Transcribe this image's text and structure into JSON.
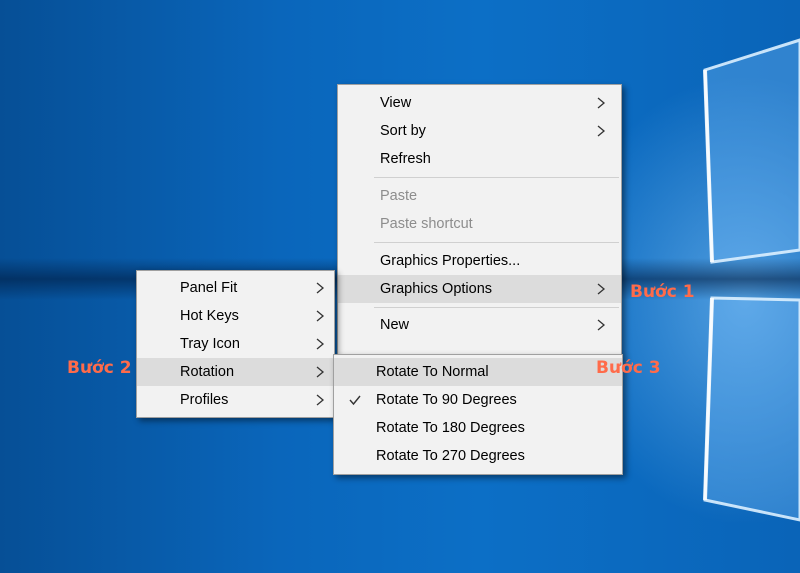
{
  "main_menu": {
    "items": [
      {
        "label": "View"
      },
      {
        "label": "Sort by"
      },
      {
        "label": "Refresh"
      },
      {
        "label": "Paste"
      },
      {
        "label": "Paste shortcut"
      },
      {
        "label": "Graphics Properties..."
      },
      {
        "label": "Graphics Options"
      },
      {
        "label": "New"
      }
    ]
  },
  "graphics_submenu": {
    "items": [
      {
        "label": "Panel Fit"
      },
      {
        "label": "Hot Keys"
      },
      {
        "label": "Tray Icon"
      },
      {
        "label": "Rotation"
      },
      {
        "label": "Profiles"
      }
    ]
  },
  "rotation_submenu": {
    "items": [
      {
        "label": "Rotate To Normal"
      },
      {
        "label": "Rotate To 90 Degrees",
        "checked": true
      },
      {
        "label": "Rotate To 180 Degrees"
      },
      {
        "label": "Rotate To 270 Degrees"
      }
    ]
  },
  "annotations": {
    "step1": "Bước 1",
    "step2": "Bước 2",
    "step3": "Bước 3"
  },
  "colors": {
    "annotation": "#ff6b4a",
    "menu_background": "#f2f2f2",
    "menu_highlight": "#dcdcdc",
    "disabled_text": "#8d8d8d"
  },
  "icons": {
    "submenu_arrow": "chevron-right-icon",
    "checkmark": "checkmark-icon"
  }
}
